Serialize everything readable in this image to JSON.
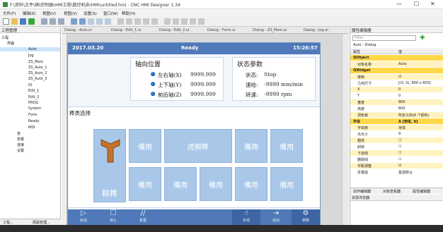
{
  "window": {
    "title": "F:\\资料\\文件\\绵\\控制器\\HMI工程\\数控机床\\HMI\\untitled.hmi - CNC HMI Designer 1.34",
    "minimize": "—",
    "maximize": "☐",
    "close": "✕"
  },
  "menu": [
    "文件(F)",
    "编辑(E)",
    "视图(V)",
    "视图(V)",
    "设置(S)",
    "窗口(W)",
    "帮助(H)"
  ],
  "left_panel": {
    "title": "工程管理",
    "tree": [
      {
        "label": "工程",
        "level": 0
      },
      {
        "label": "界面",
        "level": 1
      },
      {
        "label": "Auto",
        "level": 2,
        "selected": true
      },
      {
        "label": "Jog",
        "level": 2
      },
      {
        "label": "ZS_Main",
        "level": 2
      },
      {
        "label": "ZS_Auto_1",
        "level": 2
      },
      {
        "label": "ZS_Auto_2",
        "level": 2
      },
      {
        "label": "ZS_Auto_3",
        "level": 2
      },
      {
        "label": "IO",
        "level": 2
      },
      {
        "label": "Edit_1",
        "level": 2
      },
      {
        "label": "Edit_2",
        "level": 2
      },
      {
        "label": "PROG",
        "level": 2
      },
      {
        "label": "Syslem",
        "level": 2
      },
      {
        "label": "Form",
        "level": 2
      },
      {
        "label": "Ready",
        "level": 2
      },
      {
        "label": "MDI",
        "level": 2
      },
      {
        "label": "变",
        "level": 1
      },
      {
        "label": "变量",
        "level": 1
      },
      {
        "label": "连接",
        "level": 1
      },
      {
        "label": "设置",
        "level": 1
      }
    ],
    "bottom_tabs": [
      "工程...",
      "局属管理..."
    ]
  },
  "doc_tabs": [
    "Dialog - Auto.ui",
    "Dialog - Edit_1.ui",
    "Dialog - Edit_2.ui",
    "Dialog - Form.ui",
    "Dialog - ZS_Main.ui",
    "Dialog - Jog.ui"
  ],
  "hmi": {
    "date": "2017.03.20",
    "state": "Ready",
    "time": "15:26:57",
    "axis_title": "轴向位置",
    "axes": [
      {
        "label": "左右轴(X)",
        "value": "9999.999"
      },
      {
        "label": "上下轴(Y)",
        "value": "9999.999"
      },
      {
        "label": "前后轴(Z)",
        "value": "9999.999"
      }
    ],
    "status_title": "状态参数",
    "status": [
      {
        "label": "状态:",
        "value": "Stop"
      },
      {
        "label": "速给:",
        "value": "-9999 mm/min"
      },
      {
        "label": "转速:",
        "value": "-9999 rpm"
      }
    ],
    "select_title": "榫类选择",
    "big_button": "粽榫",
    "long_button": "虎脚榫",
    "button_label": "備用",
    "bottom_buttons": [
      {
        "icon": "▷",
        "label": "启动"
      },
      {
        "icon": "☐",
        "label": "停止"
      },
      {
        "icon": "//",
        "label": "复置"
      },
      {
        "icon": "☝",
        "label": "手动"
      },
      {
        "icon": "⇥",
        "label": "自动"
      },
      {
        "icon": "⚙",
        "label": "参数"
      }
    ]
  },
  "right_panel": {
    "title": "属性编辑器",
    "filter_placeholder": "Filter",
    "object": "Auto : Dialog",
    "headers": [
      "属性",
      "值"
    ],
    "rows": [
      {
        "k": "QObject",
        "v": "",
        "cat": true
      },
      {
        "k": "对象名称",
        "v": "Auto"
      },
      {
        "k": "QWidget",
        "v": "",
        "cat": true
      },
      {
        "k": "使用",
        "v": "☑"
      },
      {
        "k": "几何尺寸",
        "v": "[(0, 0), 800 x 600]"
      },
      {
        "k": "X",
        "v": "0"
      },
      {
        "k": "Y",
        "v": "0"
      },
      {
        "k": "宽度",
        "v": "800"
      },
      {
        "k": "高度",
        "v": "600"
      },
      {
        "k": "调色板",
        "v": "所定义的(6 个颜色)"
      },
      {
        "k": "字体",
        "v": "A [宋体, 9]",
        "cat": true
      },
      {
        "k": "字体族",
        "v": "宋体"
      },
      {
        "k": "点大小",
        "v": "9"
      },
      {
        "k": "粗体",
        "v": "☐"
      },
      {
        "k": "斜体",
        "v": "☐"
      },
      {
        "k": "下划线",
        "v": "☐"
      },
      {
        "k": "删除线",
        "v": "☐"
      },
      {
        "k": "字距调整",
        "v": "☑"
      },
      {
        "k": "反锯齿",
        "v": "首选默认"
      }
    ],
    "tabs": [
      "动作编辑器",
      "对象查看器",
      "属性编辑器"
    ],
    "resource_title": "资源浏览器"
  },
  "colors": {
    "hmi_header": "#4f79b8",
    "hmi_button": "#a9c8e9",
    "category": "#ffd84a"
  }
}
